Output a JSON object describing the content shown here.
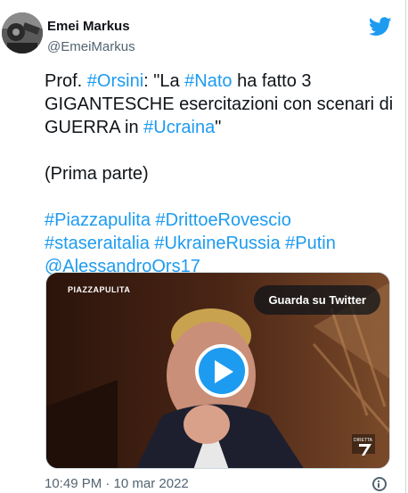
{
  "author": {
    "name": "Emei Markus",
    "handle": "@EmeiMarkus"
  },
  "tweet": {
    "line1": [
      {
        "text": "Prof. ",
        "tag": false
      },
      {
        "text": "#Orsini",
        "tag": true
      },
      {
        "text": ": \"La ",
        "tag": false
      },
      {
        "text": "#Nato",
        "tag": true
      },
      {
        "text": " ha fatto 3 GIGANTESCHE esercitazioni con scenari di GUERRA in ",
        "tag": false
      },
      {
        "text": "#Ucraina",
        "tag": true
      },
      {
        "text": "\"",
        "tag": false
      }
    ],
    "line2": "(Prima parte)",
    "tags": [
      "#Piazzapulita",
      "#DrittoeRovescio",
      "#staseraitalia",
      "#UkraineRussia",
      "#Putin",
      "@AlessandroOrs17"
    ]
  },
  "media": {
    "watch_label": "Guarda su Twitter",
    "brand_label": "PIAZZAPULITA",
    "channel_logo": "la7-logo"
  },
  "timestamp": "10:49 PM · 10 mar 2022",
  "colors": {
    "accent": "#1d9bf0",
    "text": "#0f1419",
    "muted": "#536471"
  }
}
